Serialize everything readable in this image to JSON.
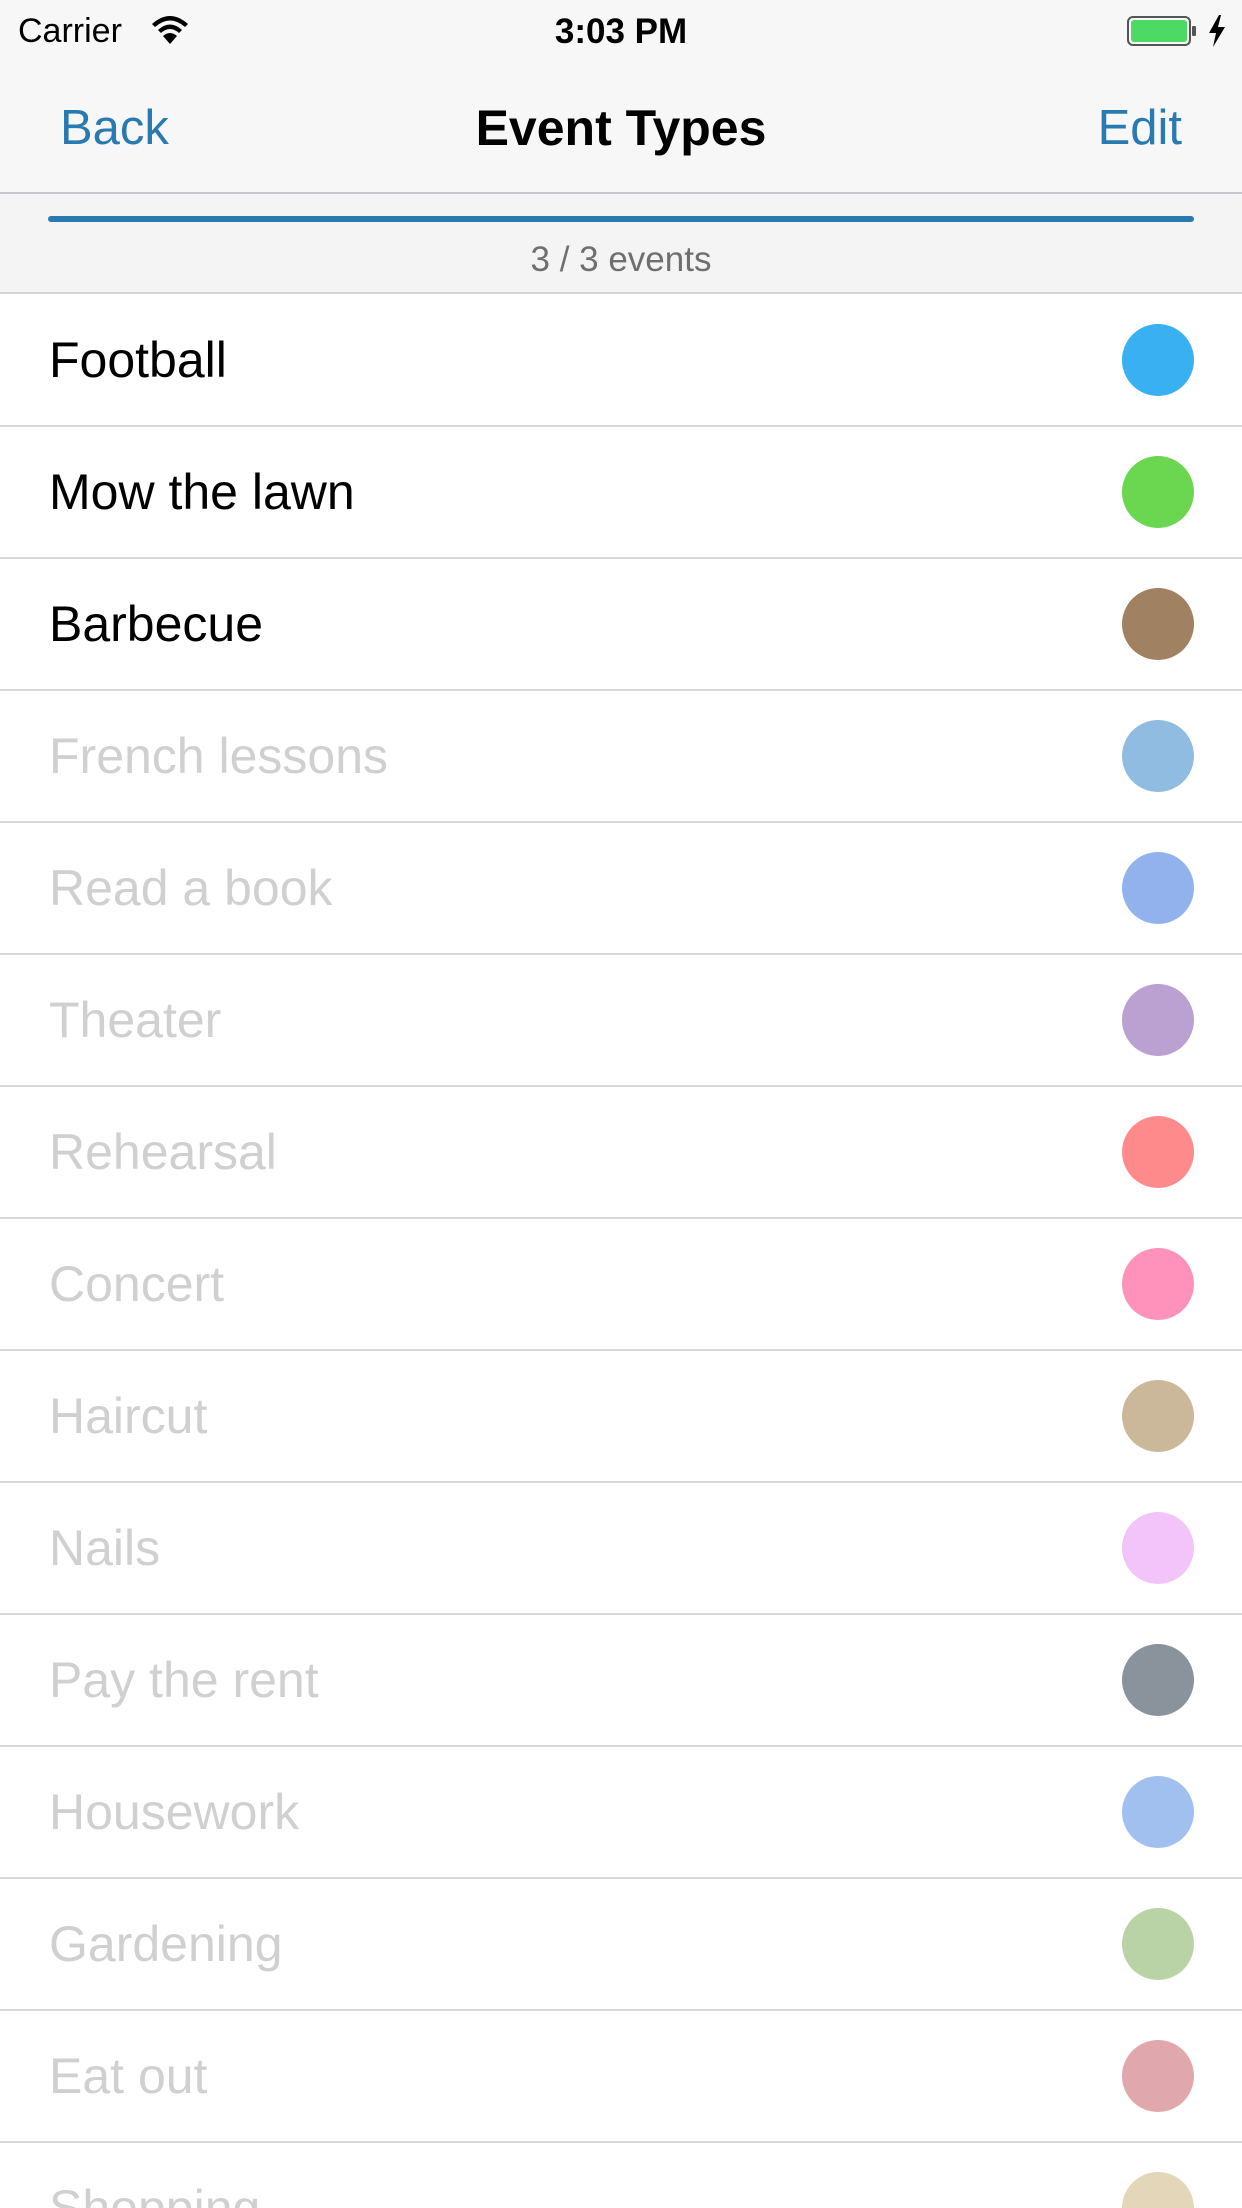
{
  "status_bar": {
    "carrier": "Carrier",
    "time": "3:03 PM",
    "battery_color": "#4cd964"
  },
  "nav": {
    "back_label": "Back",
    "title": "Event Types",
    "edit_label": "Edit",
    "accent_color": "#2a7ab2"
  },
  "summary": {
    "text": "3 / 3 events",
    "progress_fraction": 1.0
  },
  "event_types": [
    {
      "label": "Football",
      "color": "#38b0f2",
      "enabled": true
    },
    {
      "label": "Mow the lawn",
      "color": "#6bd650",
      "enabled": true
    },
    {
      "label": "Barbecue",
      "color": "#a08162",
      "enabled": true
    },
    {
      "label": "French lessons",
      "color": "#8fbce0",
      "enabled": false
    },
    {
      "label": "Read a book",
      "color": "#92b2ee",
      "enabled": false
    },
    {
      "label": "Theater",
      "color": "#bba0d2",
      "enabled": false
    },
    {
      "label": "Rehearsal",
      "color": "#ff8a8c",
      "enabled": false
    },
    {
      "label": "Concert",
      "color": "#ff92ba",
      "enabled": false
    },
    {
      "label": "Haircut",
      "color": "#cbb89b",
      "enabled": false
    },
    {
      "label": "Nails",
      "color": "#f2c4fa",
      "enabled": false
    },
    {
      "label": "Pay the rent",
      "color": "#8a929c",
      "enabled": false
    },
    {
      "label": "Housework",
      "color": "#a1c0f0",
      "enabled": false
    },
    {
      "label": "Gardening",
      "color": "#b9d3a7",
      "enabled": false
    },
    {
      "label": "Eat out",
      "color": "#e0a8ad",
      "enabled": false
    },
    {
      "label": "Shopping",
      "color": "#e4d7b9",
      "enabled": false
    }
  ]
}
